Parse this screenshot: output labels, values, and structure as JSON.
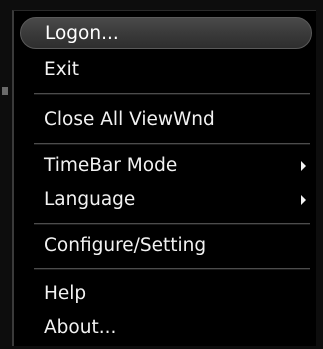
{
  "menu": {
    "items": [
      {
        "label": "Logon..."
      },
      {
        "label": "Exit"
      },
      {
        "label": "Close All ViewWnd"
      },
      {
        "label": "TimeBar Mode",
        "submenu": true
      },
      {
        "label": "Language",
        "submenu": true
      },
      {
        "label": "Configure/Setting"
      },
      {
        "label": "Help"
      },
      {
        "label": "About..."
      }
    ],
    "highlighted_item": "Logon...",
    "icons": {
      "submenu": "submenu-arrow-icon"
    },
    "colors": {
      "background": "#000000",
      "text": "#f2f2f2",
      "highlight": "#3a3a3a",
      "separator": "#4c4c4c"
    }
  }
}
